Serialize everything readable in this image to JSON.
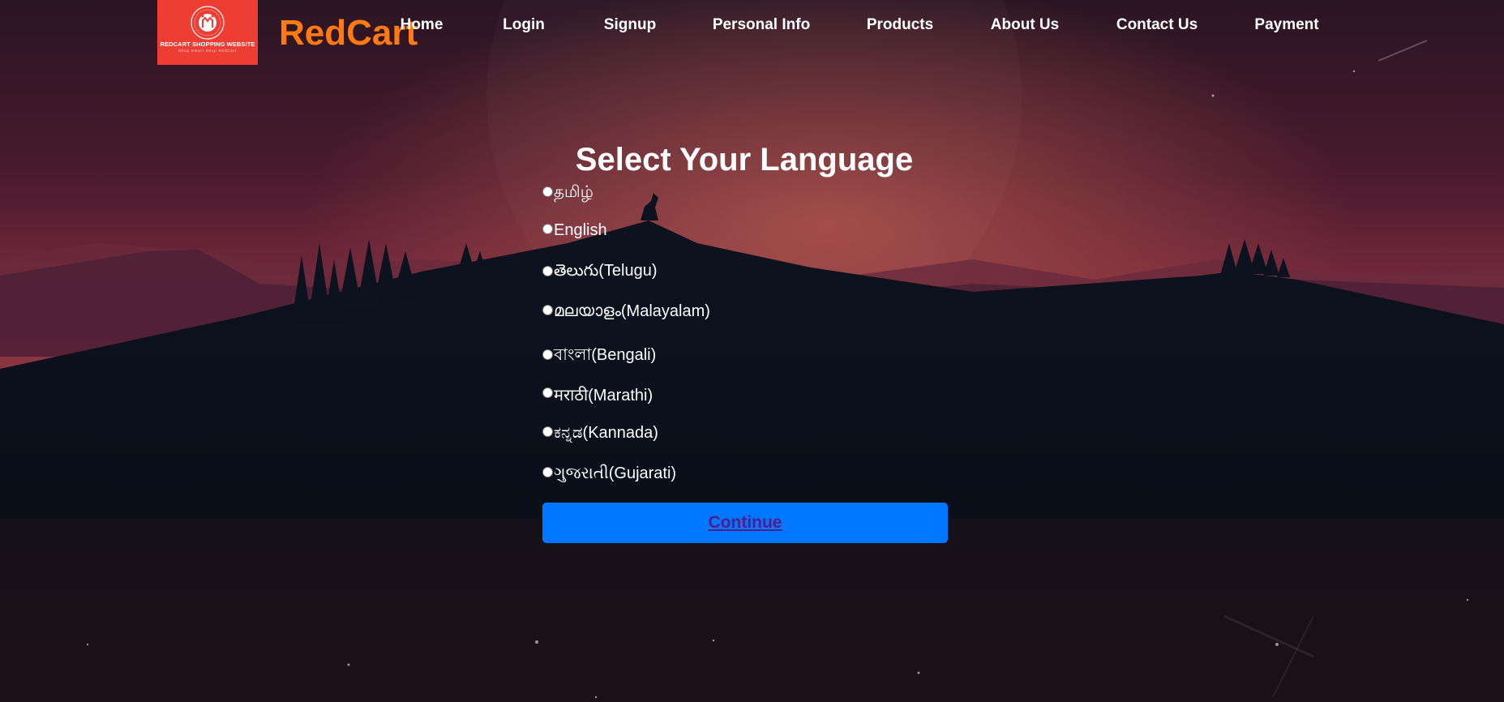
{
  "brand": {
    "name": "RedCart",
    "logo_caption": "REDCART SHOPPING WEBSITE",
    "logo_tagline": "Shop Smart Shop RedCart",
    "logo_color": "#ee3e34",
    "name_color": "#ff7a12"
  },
  "nav": {
    "items": [
      {
        "label": "Home"
      },
      {
        "label": "Login"
      },
      {
        "label": "Signup"
      },
      {
        "label": "Personal Info"
      },
      {
        "label": "Products"
      },
      {
        "label": "About Us"
      },
      {
        "label": "Contact Us"
      },
      {
        "label": "Payment"
      }
    ]
  },
  "main": {
    "title": "Select Your Language",
    "options": [
      {
        "label": "தமிழ்"
      },
      {
        "label": "English"
      },
      {
        "label": "తెలుగు(Telugu)"
      },
      {
        "label": "മലയാളം(Malayalam)"
      },
      {
        "label": "বাংলা(Bengali)"
      },
      {
        "label": "मराठी(Marathi)"
      },
      {
        "label": "ಕನ್ನಡ(Kannada)"
      },
      {
        "label": "ગુજરાતી(Gujarati)"
      }
    ],
    "continue_label": "Continue",
    "button_color": "#0077ff"
  }
}
